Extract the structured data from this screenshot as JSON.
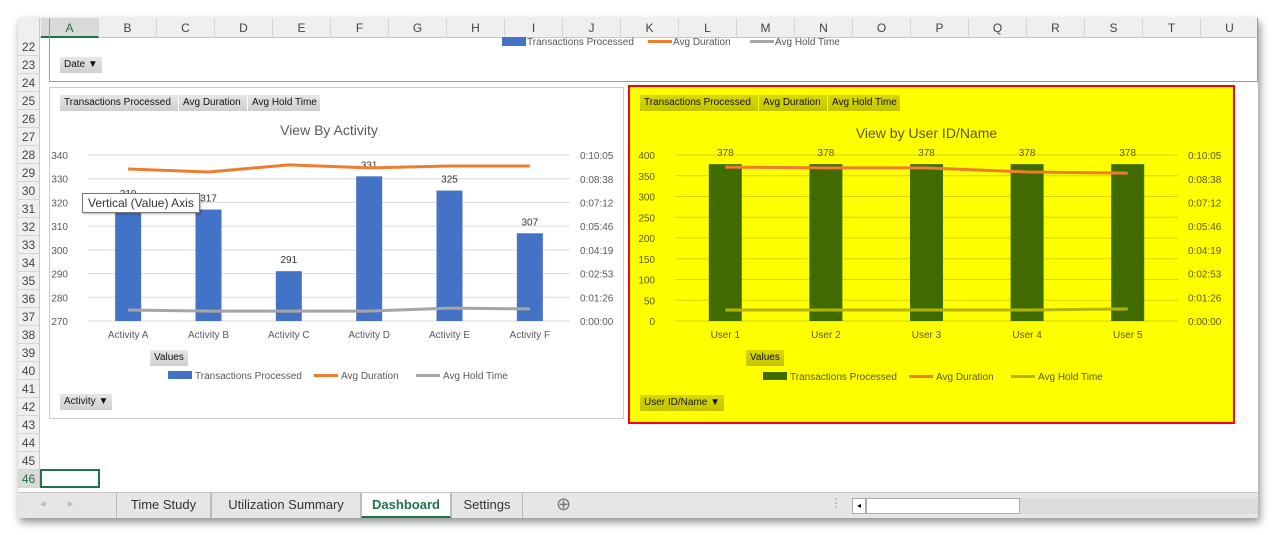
{
  "columns": [
    "A",
    "B",
    "C",
    "D",
    "E",
    "F",
    "G",
    "H",
    "I",
    "J",
    "K",
    "L",
    "M",
    "N",
    "O",
    "P",
    "Q",
    "R",
    "S",
    "T",
    "U"
  ],
  "rows": [
    "22",
    "23",
    "24",
    "25",
    "26",
    "27",
    "28",
    "29",
    "30",
    "31",
    "32",
    "33",
    "34",
    "35",
    "36",
    "37",
    "38",
    "39",
    "40",
    "41",
    "42",
    "43",
    "44",
    "45",
    "46"
  ],
  "selected_cell": "A46",
  "top_chart": {
    "legend": [
      "Transactions Processed",
      "Avg Duration",
      "Avg Hold Time"
    ],
    "filter_button": "Date ▼"
  },
  "tooltip": "Vertical (Value) Axis",
  "colors": {
    "blue": "#4472c4",
    "orange": "#ed7d31",
    "gray": "#a5a5a5",
    "green": "#3f6b00",
    "olive": "#b4b400",
    "highlight": "#ffff00",
    "border_red": "#ff0000"
  },
  "chart_data": [
    {
      "type": "bar+line",
      "title": "View By Activity",
      "field_buttons": [
        "Transactions  Processed",
        "Avg Duration",
        "Avg Hold Time"
      ],
      "values_button": "Values",
      "axis_button": "Activity ▼",
      "categories": [
        "Activity A",
        "Activity B",
        "Activity C",
        "Activity D",
        "Activity E",
        "Activity F"
      ],
      "ylim": [
        270,
        340
      ],
      "yticks": [
        "270",
        "280",
        "290",
        "300",
        "310",
        "320",
        "330",
        "340"
      ],
      "y2ticks": [
        "0:00:00",
        "0:01:26",
        "0:02:53",
        "0:04:19",
        "0:05:46",
        "0:07:12",
        "0:08:38",
        "0:10:05"
      ],
      "y2lim": [
        "0:00:00",
        "0:10:05"
      ],
      "grid": true,
      "legend_position": "bottom",
      "series": [
        {
          "name": "Transactions Processed",
          "kind": "bar",
          "axis": "primary",
          "values": [
            319,
            317,
            291,
            331,
            325,
            307
          ],
          "labels": [
            "319",
            "317",
            "291",
            "331",
            "325",
            "307"
          ]
        },
        {
          "name": "Avg Duration",
          "kind": "line",
          "axis": "secondary",
          "values": [
            "0:09:14",
            "0:09:03",
            "0:09:29",
            "0:09:18",
            "0:09:25",
            "0:09:25"
          ]
        },
        {
          "name": "Avg Hold Time",
          "kind": "line",
          "axis": "secondary",
          "values": [
            "0:00:40",
            "0:00:36",
            "0:00:36",
            "0:00:36",
            "0:00:47",
            "0:00:44"
          ]
        }
      ]
    },
    {
      "type": "bar+line",
      "title": "View by User ID/Name",
      "field_buttons": [
        "Transactions  Processed",
        "Avg Duration",
        "Avg Hold Time"
      ],
      "values_button": "Values",
      "axis_button": "User ID/Name  ▼",
      "categories": [
        "User 1",
        "User 2",
        "User 3",
        "User 4",
        "User 5"
      ],
      "ylim": [
        0,
        400
      ],
      "yticks": [
        "0",
        "50",
        "100",
        "150",
        "200",
        "250",
        "300",
        "350",
        "400"
      ],
      "y2ticks": [
        "0:00:00",
        "0:01:26",
        "0:02:53",
        "0:04:19",
        "0:05:46",
        "0:07:12",
        "0:08:38",
        "0:10:05"
      ],
      "y2lim": [
        "0:00:00",
        "0:10:05"
      ],
      "grid": true,
      "legend_position": "bottom",
      "highlighted": true,
      "series": [
        {
          "name": "Transactions Processed",
          "kind": "bar",
          "axis": "primary",
          "values": [
            378,
            378,
            378,
            378,
            378
          ],
          "labels": [
            "378",
            "378",
            "378",
            "378",
            "378"
          ]
        },
        {
          "name": "Avg Duration",
          "kind": "line",
          "axis": "secondary",
          "values": [
            "0:09:21",
            "0:09:18",
            "0:09:18",
            "0:09:03",
            "0:08:59"
          ]
        },
        {
          "name": "Avg Hold Time",
          "kind": "line",
          "axis": "secondary",
          "values": [
            "0:00:40",
            "0:00:40",
            "0:00:40",
            "0:00:40",
            "0:00:44"
          ]
        }
      ]
    }
  ],
  "sheet_tabs": [
    {
      "label": "Time Study"
    },
    {
      "label": "Utilization Summary"
    },
    {
      "label": "Dashboard",
      "active": true
    },
    {
      "label": "Settings"
    }
  ],
  "new_sheet_label": "⊕"
}
